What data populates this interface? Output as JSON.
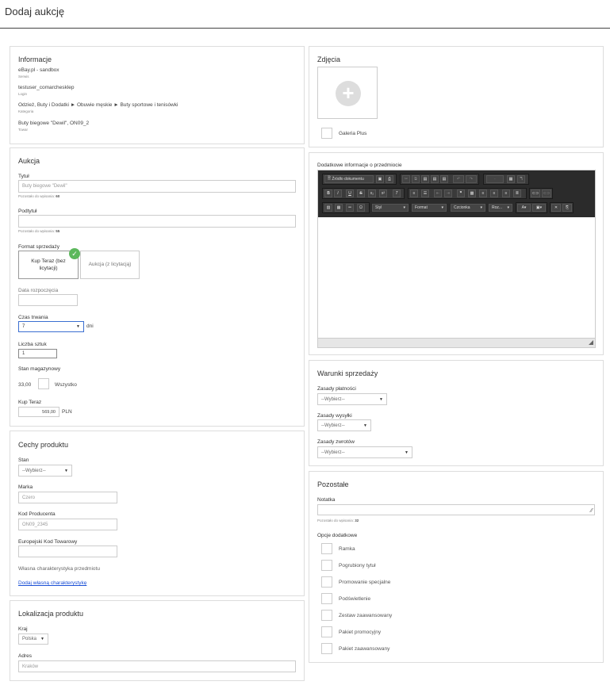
{
  "page": {
    "title": "Dodaj aukcję"
  },
  "info": {
    "title": "Informacje",
    "service_value": "eBay.pl - sandbox",
    "service_label": "Serwis",
    "login_value": "testuser_comarchesklep",
    "login_label": "Login",
    "category_value": "Odzież, Buty i Dodatki ► Obuwie męskie ► Buty sportowe i tenisówki",
    "category_label": "Kategoria",
    "product_value": "Buty biegowe \"Dewil\", ON09_2",
    "product_label": "Towar"
  },
  "auction": {
    "title": "Aukcja",
    "title_label": "Tytuł",
    "title_value": "Buty biegowe \"Dewil\"",
    "title_hint": "Pozostało do wpisania:",
    "title_remaining": "60",
    "subtitle_label": "Podtytuł",
    "subtitle_hint": "Pozostało do wpisania:",
    "subtitle_remaining": "55",
    "format_label": "Format sprzedaży",
    "format_buy_now": "Kup Teraz (bez licytacji)",
    "format_auction": "Aukcja (z licytacją)",
    "start_date_label": "Data rozpoczęcia",
    "duration_label": "Czas trwania",
    "duration_value": "7",
    "duration_unit": "dni",
    "quantity_label": "Liczba sztuk",
    "quantity_value": "1",
    "stock_label": "Stan magazynowy",
    "stock_value": "33,00",
    "stock_all_label": "Wszystko",
    "buy_now_label": "Kup Teraz",
    "buy_now_value": "569,00",
    "currency": "PLN"
  },
  "features": {
    "title": "Cechy produktu",
    "condition_label": "Stan",
    "condition_value": "--Wybierz--",
    "brand_label": "Marka",
    "brand_value": "Czero",
    "mpn_label": "Kod Producenta",
    "mpn_value": "ON09_2345",
    "ean_label": "Europejski Kod Towarowy",
    "custom_label": "Własna charakterystyka przedmiotu",
    "custom_link": "Dodaj własną charakterystykę"
  },
  "location": {
    "title": "Lokalizacja produktu",
    "country_label": "Kraj",
    "country_value": "Polska",
    "address_label": "Adres",
    "address_value": "Kraków"
  },
  "photos": {
    "title": "Zdjęcia",
    "gallery_plus": "Galeria Plus"
  },
  "description": {
    "label": "Dodatkowe informacje o przedmiocie",
    "source_button": "Źródło dokumentu",
    "style_dd": "Styl",
    "format_dd": "Format",
    "font_dd": "Czcionka",
    "size_dd": "Roz..."
  },
  "terms": {
    "title": "Warunki sprzedaży",
    "payment_label": "Zasady płatności",
    "payment_value": "--Wybierz--",
    "shipping_label": "Zasady wysyłki",
    "shipping_value": "--Wybierz--",
    "returns_label": "Zasady zwrotów",
    "returns_value": "--Wybierz--"
  },
  "other": {
    "title": "Pozostałe",
    "note_label": "Notatka",
    "note_hint": "Pozostało do wpisania:",
    "note_remaining": "32",
    "options_label": "Opcje dodatkowe",
    "options": [
      "Ramka",
      "Pogrubiony tytuł",
      "Promowanie specjalne",
      "Podświetlenie",
      "Zestaw zaawansowany",
      "Pakiet promocyjny",
      "Pakiet zaawansowany"
    ]
  },
  "colors": {
    "accent_check": "#5cb85c",
    "link": "#1a4fd6",
    "editor_bar": "#2b2b2b"
  }
}
